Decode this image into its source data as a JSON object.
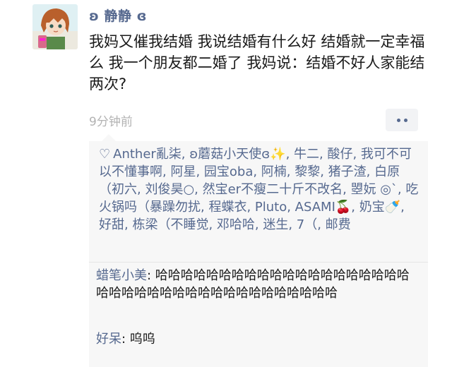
{
  "post": {
    "author": "ʚ 静静 ɞ",
    "text": "我妈又催我结婚 我说结婚有什么好 结婚就一定幸福么 我一个朋友都二婚了 我妈说：结婚不好人家能结两次?",
    "time": "9分钟前"
  },
  "likes": {
    "text": "Anther亂柒, ʚ蘑菇小天使ɞ✨, 牛二, 酸仔, 我可不可以不懂事啊, 阿星, 园宝oba, 阿楠, 黎黎, 猪子渣, 白原（初六, 刘俊昊○, 然宝er不瘦二十斤不改名, 曌妧 ◎`, 吃火锅吗（暴躁勿扰, 程蝶衣, Pluto, ASAMI🍒, 奶宝🍼, 好甜, 栋梁（不睡觉, 邓哈哈, 迷生, 7（, 邮费"
  },
  "comments": [
    {
      "name": "蜡笔小美",
      "text": "哈哈哈哈哈哈哈哈哈哈哈哈哈哈哈哈哈哈哈哈哈哈哈哈哈哈哈哈哈哈哈哈哈哈哈哈哈哈哈"
    },
    {
      "name": "好呆",
      "text": "呜呜"
    },
    {
      "name": "",
      "text": ""
    }
  ],
  "colors": {
    "link": "#56698f",
    "time": "#b3b3b3",
    "panel": "#f7f7f7"
  }
}
